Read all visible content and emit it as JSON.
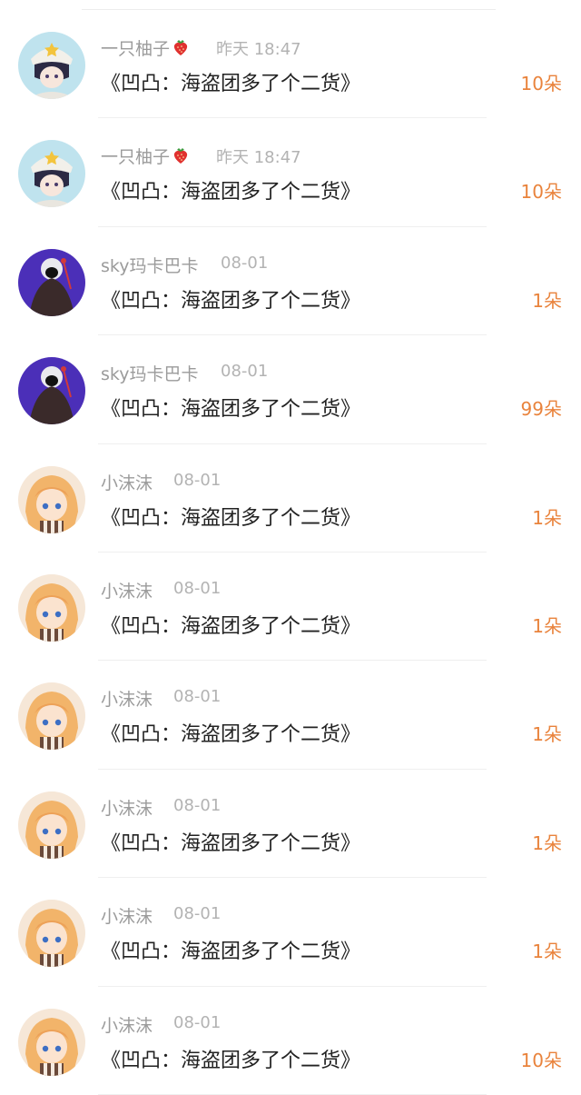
{
  "gifts": [
    {
      "user": "一只柚子",
      "badge": "strawberry-icon",
      "date": "昨天 18:47",
      "title": "《凹凸：海盗团多了个二货》",
      "amount": "10朵",
      "avatar": "avatar-snow-hat"
    },
    {
      "user": "一只柚子",
      "badge": "strawberry-icon",
      "date": "昨天 18:47",
      "title": "《凹凸：海盗团多了个二货》",
      "amount": "10朵",
      "avatar": "avatar-snow-hat"
    },
    {
      "user": "sky玛卡巴卡",
      "badge": "",
      "date": "08-01",
      "title": "《凹凸：海盗团多了个二货》",
      "amount": "1朵",
      "avatar": "avatar-purple-cloak"
    },
    {
      "user": "sky玛卡巴卡",
      "badge": "",
      "date": "08-01",
      "title": "《凹凸：海盗团多了个二货》",
      "amount": "99朵",
      "avatar": "avatar-purple-cloak"
    },
    {
      "user": "小沫沫",
      "badge": "",
      "date": "08-01",
      "title": "《凹凸：海盗团多了个二货》",
      "amount": "1朵",
      "avatar": "avatar-orange-hair"
    },
    {
      "user": "小沫沫",
      "badge": "",
      "date": "08-01",
      "title": "《凹凸：海盗团多了个二货》",
      "amount": "1朵",
      "avatar": "avatar-orange-hair"
    },
    {
      "user": "小沫沫",
      "badge": "",
      "date": "08-01",
      "title": "《凹凸：海盗团多了个二货》",
      "amount": "1朵",
      "avatar": "avatar-orange-hair"
    },
    {
      "user": "小沫沫",
      "badge": "",
      "date": "08-01",
      "title": "《凹凸：海盗团多了个二货》",
      "amount": "1朵",
      "avatar": "avatar-orange-hair"
    },
    {
      "user": "小沫沫",
      "badge": "",
      "date": "08-01",
      "title": "《凹凸：海盗团多了个二货》",
      "amount": "1朵",
      "avatar": "avatar-orange-hair"
    },
    {
      "user": "小沫沫",
      "badge": "",
      "date": "08-01",
      "title": "《凹凸：海盗团多了个二货》",
      "amount": "10朵",
      "avatar": "avatar-orange-hair"
    }
  ],
  "colors": {
    "username": "#9b9b9b",
    "date": "#b3b3b3",
    "title": "#222222",
    "amount": "#e9833c",
    "divider": "#efefef"
  }
}
